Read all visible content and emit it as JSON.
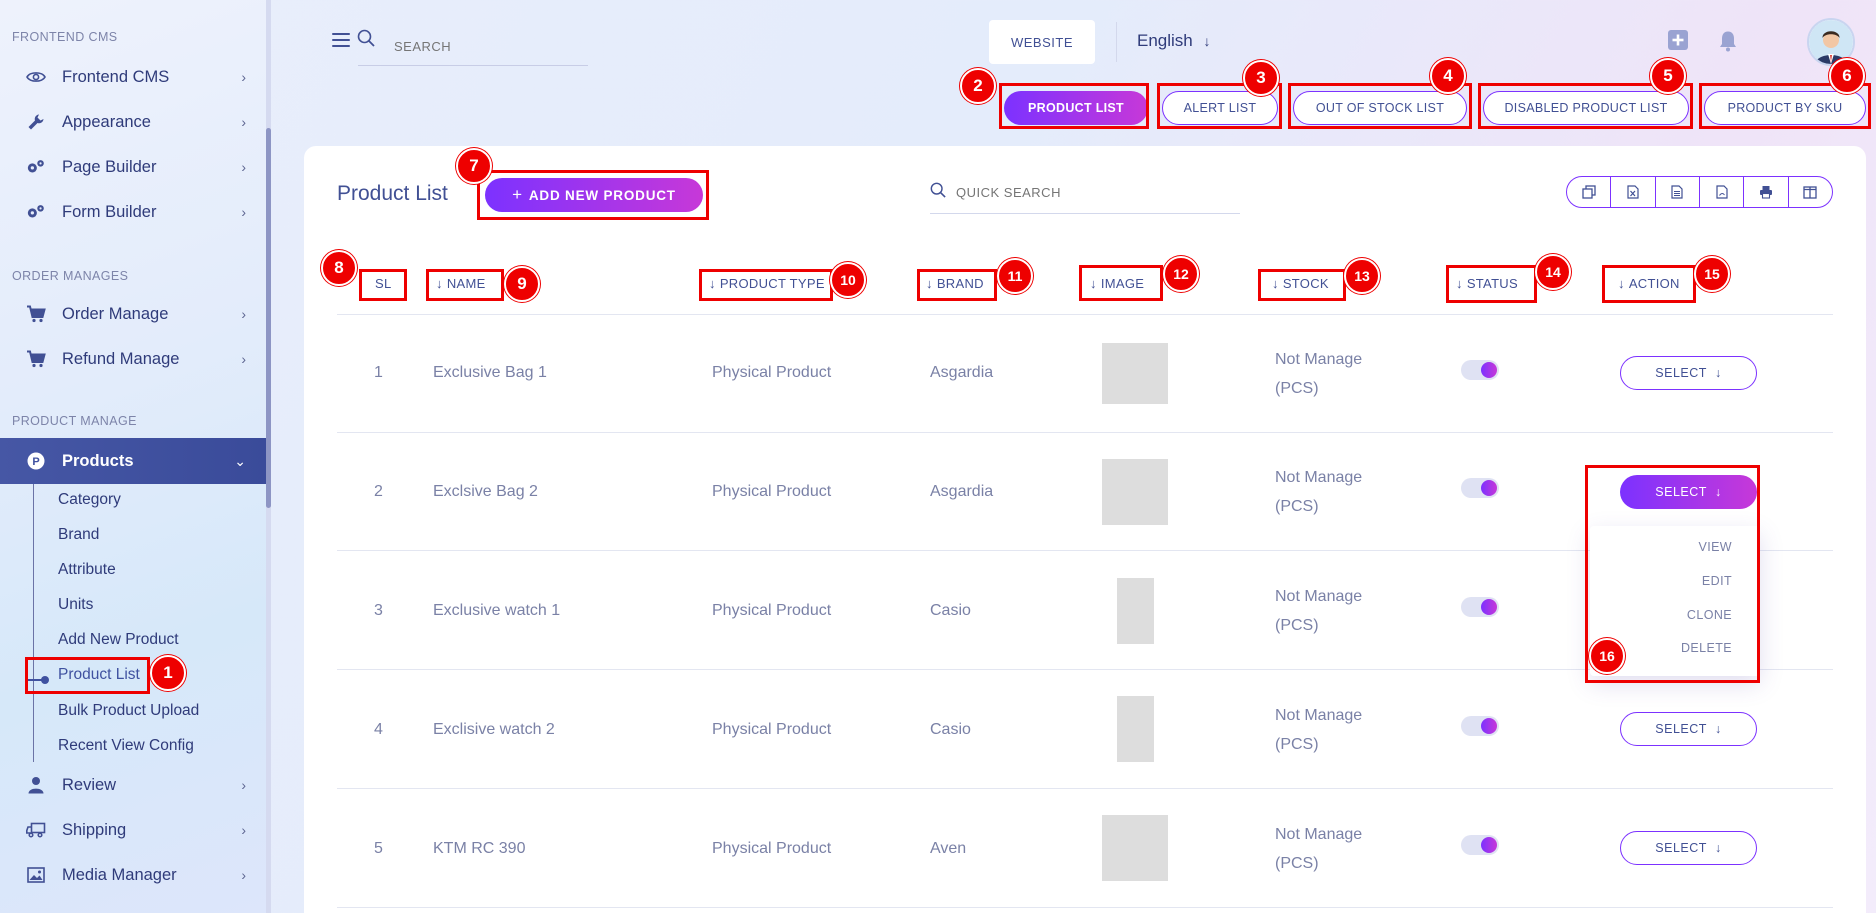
{
  "sidebar": {
    "sections": {
      "frontend_cms": "FRONTEND CMS",
      "order_manages": "ORDER MANAGES",
      "product_manage": "PRODUCT MANAGE"
    },
    "items": [
      {
        "label": "Frontend CMS",
        "icon": "eye-icon"
      },
      {
        "label": "Appearance",
        "icon": "wrench-icon"
      },
      {
        "label": "Page Builder",
        "icon": "gears-icon"
      },
      {
        "label": "Form Builder",
        "icon": "gears-icon"
      },
      {
        "label": "Order Manage",
        "icon": "cart-icon"
      },
      {
        "label": "Refund Manage",
        "icon": "cart-icon"
      },
      {
        "label": "Products",
        "icon": "product-p-icon"
      },
      {
        "label": "Review",
        "icon": "user-icon"
      },
      {
        "label": "Shipping",
        "icon": "truck-icon"
      },
      {
        "label": "Media Manager",
        "icon": "image-icon"
      }
    ],
    "product_submenu": [
      "Category",
      "Brand",
      "Attribute",
      "Units",
      "Add New Product",
      "Product List",
      "Bulk Product Upload",
      "Recent View Config"
    ]
  },
  "header": {
    "search_placeholder": "SEARCH",
    "website_label": "WEBSITE",
    "language": "English"
  },
  "tabs": [
    "PRODUCT LIST",
    "ALERT LIST",
    "OUT OF STOCK LIST",
    "DISABLED PRODUCT LIST",
    "PRODUCT BY SKU"
  ],
  "main": {
    "title": "Product List",
    "add_button": "ADD NEW PRODUCT",
    "quick_search_placeholder": "QUICK SEARCH",
    "export_icons": [
      "copy-icon",
      "excel-icon",
      "csv-icon",
      "pdf-icon",
      "print-icon",
      "columns-icon"
    ]
  },
  "table": {
    "headers": [
      "SL",
      "NAME",
      "PRODUCT TYPE",
      "BRAND",
      "IMAGE",
      "STOCK",
      "STATUS",
      "ACTION"
    ],
    "rows": [
      {
        "sl": "1",
        "name": "Exclusive Bag 1",
        "type": "Physical Product",
        "brand": "Asgardia",
        "stock_1": "Not Manage",
        "stock_2": "(PCS)",
        "action": "SELECT"
      },
      {
        "sl": "2",
        "name": "Exclsive Bag 2",
        "type": "Physical Product",
        "brand": "Asgardia",
        "stock_1": "Not Manage",
        "stock_2": "(PCS)",
        "action": "SELECT"
      },
      {
        "sl": "3",
        "name": "Exclusive watch 1",
        "type": "Physical Product",
        "brand": "Casio",
        "stock_1": "Not Manage",
        "stock_2": "(PCS)",
        "action": "SELECT"
      },
      {
        "sl": "4",
        "name": "Exclisive watch 2",
        "type": "Physical Product",
        "brand": "Casio",
        "stock_1": "Not Manage",
        "stock_2": "(PCS)",
        "action": "SELECT"
      },
      {
        "sl": "5",
        "name": "KTM RC 390",
        "type": "Physical Product",
        "brand": "Aven",
        "stock_1": "Not Manage",
        "stock_2": "(PCS)",
        "action": "SELECT"
      }
    ],
    "action_menu": [
      "VIEW",
      "EDIT",
      "CLONE",
      "DELETE"
    ]
  },
  "annotations": [
    "1",
    "2",
    "3",
    "4",
    "5",
    "6",
    "7",
    "8",
    "9",
    "10",
    "11",
    "12",
    "13",
    "14",
    "15",
    "16"
  ],
  "colors": {
    "accent_start": "#7c32ff",
    "accent_end": "#c738d8",
    "text_primary": "#415094",
    "sidebar_active": "#3f51a0",
    "annotation_red": "#ee0000"
  }
}
